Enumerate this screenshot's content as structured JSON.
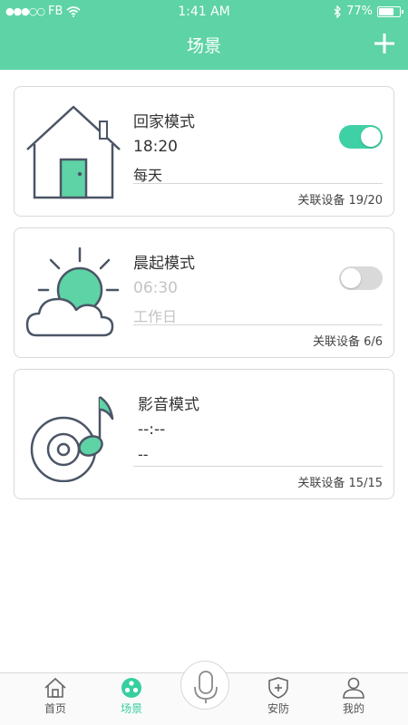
{
  "status_bar": {
    "signal": "●●●○○",
    "carrier": "FB",
    "time": "1:41 AM",
    "battery": "77%",
    "battery_level": 0.77
  },
  "nav": {
    "title": "场景",
    "add_icon": "plus-icon"
  },
  "colors": {
    "brand": "#5ed3a5",
    "toggle_on": "#3fd0a6",
    "toggle_off": "#d9d9d9",
    "tab_active": "#36cfa0"
  },
  "scenes": [
    {
      "name": "回家模式",
      "time": "18:20",
      "repeat": "每天",
      "devices": "关联设备 19/20",
      "enabled": true,
      "icon": "house-icon"
    },
    {
      "name": "晨起模式",
      "time": "06:30",
      "repeat": "工作日",
      "devices": "关联设备 6/6",
      "enabled": false,
      "icon": "sunrise-cloud-icon"
    },
    {
      "name": "影音模式",
      "time": "--:--",
      "repeat": "--",
      "devices": "关联设备 15/15",
      "icon": "music-disc-icon"
    }
  ],
  "tabbar": {
    "items": [
      {
        "label": "首页",
        "icon": "home-icon"
      },
      {
        "label": "场景",
        "icon": "scene-icon",
        "active": true
      },
      {
        "label": "",
        "icon": "microphone-icon"
      },
      {
        "label": "安防",
        "icon": "shield-icon"
      },
      {
        "label": "我的",
        "icon": "user-icon"
      }
    ]
  }
}
